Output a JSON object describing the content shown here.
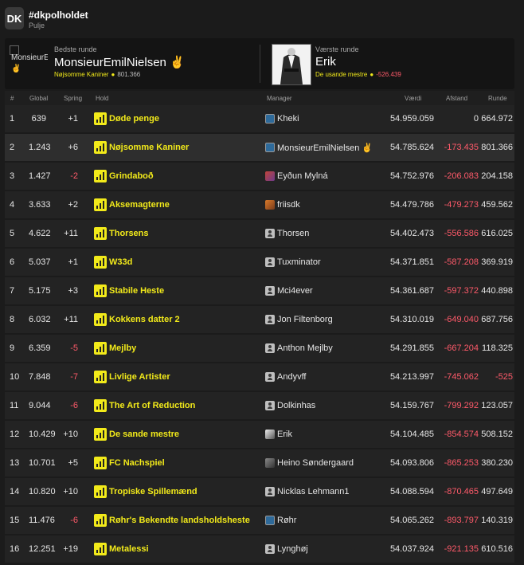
{
  "header": {
    "badge": "DK",
    "title": "#dkpolholdet",
    "subtitle": "Pulje"
  },
  "best_round": {
    "label": "Bedste runde",
    "avatar_alt": "MonsieurE",
    "avatar_emoji": "✌",
    "name": "MonsieurEmilNielsen ✌",
    "team": "Nøjsomme Kaniner",
    "points": "801.366"
  },
  "worst_round": {
    "label": "Værste runde",
    "name": "Erik",
    "team": "De usande mestre",
    "points": "-526.439"
  },
  "columns": {
    "rank": "#",
    "global": "Global",
    "spring": "Spring",
    "team": "Hold",
    "manager": "Manager",
    "value": "Værdi",
    "distance": "Afstand",
    "round": "Runde"
  },
  "colors": {
    "accent": "#f2ea1a",
    "negative": "#ff5a6a",
    "background": "#1b1b1b"
  },
  "rows": [
    {
      "rank": "1",
      "global": "639",
      "spring": "+1",
      "team": "Døde penge",
      "manager": "Kheki",
      "icon": "broken",
      "value": "54.959.059",
      "distance": "0",
      "round": "664.972"
    },
    {
      "rank": "2",
      "global": "1.243",
      "spring": "+6",
      "team": "Nøjsomme Kaniner",
      "manager": "MonsieurEmilNielsen ✌",
      "icon": "broken",
      "value": "54.785.624",
      "distance": "-173.435",
      "round": "801.366"
    },
    {
      "rank": "3",
      "global": "1.427",
      "spring": "-2",
      "team": "Grindaboð",
      "manager": "Eyðun Mylná",
      "icon": "photo-red",
      "value": "54.752.976",
      "distance": "-206.083",
      "round": "204.158"
    },
    {
      "rank": "4",
      "global": "3.633",
      "spring": "+2",
      "team": "Aksemagterne",
      "manager": "friisdk",
      "icon": "photo-orange",
      "value": "54.479.786",
      "distance": "-479.273",
      "round": "459.562"
    },
    {
      "rank": "5",
      "global": "4.622",
      "spring": "+11",
      "team": "Thorsens",
      "manager": "Thorsen",
      "icon": "generic",
      "value": "54.402.473",
      "distance": "-556.586",
      "round": "616.025"
    },
    {
      "rank": "6",
      "global": "5.037",
      "spring": "+1",
      "team": "W33d",
      "manager": "Tuxminator",
      "icon": "generic",
      "value": "54.371.851",
      "distance": "-587.208",
      "round": "369.919"
    },
    {
      "rank": "7",
      "global": "5.175",
      "spring": "+3",
      "team": "Stabile Heste",
      "manager": "Mci4ever",
      "icon": "generic",
      "value": "54.361.687",
      "distance": "-597.372",
      "round": "440.898"
    },
    {
      "rank": "8",
      "global": "6.032",
      "spring": "+11",
      "team": "Kokkens datter 2",
      "manager": "Jon Filtenborg",
      "icon": "generic",
      "value": "54.310.019",
      "distance": "-649.040",
      "round": "687.756"
    },
    {
      "rank": "9",
      "global": "6.359",
      "spring": "-5",
      "team": "Mejlby",
      "manager": "Anthon Mejlby",
      "icon": "generic",
      "value": "54.291.855",
      "distance": "-667.204",
      "round": "118.325"
    },
    {
      "rank": "10",
      "global": "7.848",
      "spring": "-7",
      "team": "Livlige Artister",
      "manager": "Andyvff",
      "icon": "generic",
      "value": "54.213.997",
      "distance": "-745.062",
      "round": "-525"
    },
    {
      "rank": "11",
      "global": "9.044",
      "spring": "-6",
      "team": "The Art of Reduction",
      "manager": "Dolkinhas",
      "icon": "generic",
      "value": "54.159.767",
      "distance": "-799.292",
      "round": "123.057"
    },
    {
      "rank": "12",
      "global": "10.429",
      "spring": "+10",
      "team": "De sande mestre",
      "manager": "Erik",
      "icon": "photo-mono",
      "value": "54.104.485",
      "distance": "-854.574",
      "round": "508.152"
    },
    {
      "rank": "13",
      "global": "10.701",
      "spring": "+5",
      "team": "FC Nachspiel",
      "manager": "Heino Søndergaard",
      "icon": "photo-grey",
      "value": "54.093.806",
      "distance": "-865.253",
      "round": "380.230"
    },
    {
      "rank": "14",
      "global": "10.820",
      "spring": "+10",
      "team": "Tropiske Spillemænd",
      "manager": "Nicklas Lehmann1",
      "icon": "generic",
      "value": "54.088.594",
      "distance": "-870.465",
      "round": "497.649"
    },
    {
      "rank": "15",
      "global": "11.476",
      "spring": "-6",
      "team": "Røhr's Bekendte landsholdsheste",
      "manager": "Røhr",
      "icon": "broken",
      "value": "54.065.262",
      "distance": "-893.797",
      "round": "140.319"
    },
    {
      "rank": "16",
      "global": "12.251",
      "spring": "+19",
      "team": "Metalessi",
      "manager": "Lynghøj",
      "icon": "generic",
      "value": "54.037.924",
      "distance": "-921.135",
      "round": "610.516"
    }
  ]
}
